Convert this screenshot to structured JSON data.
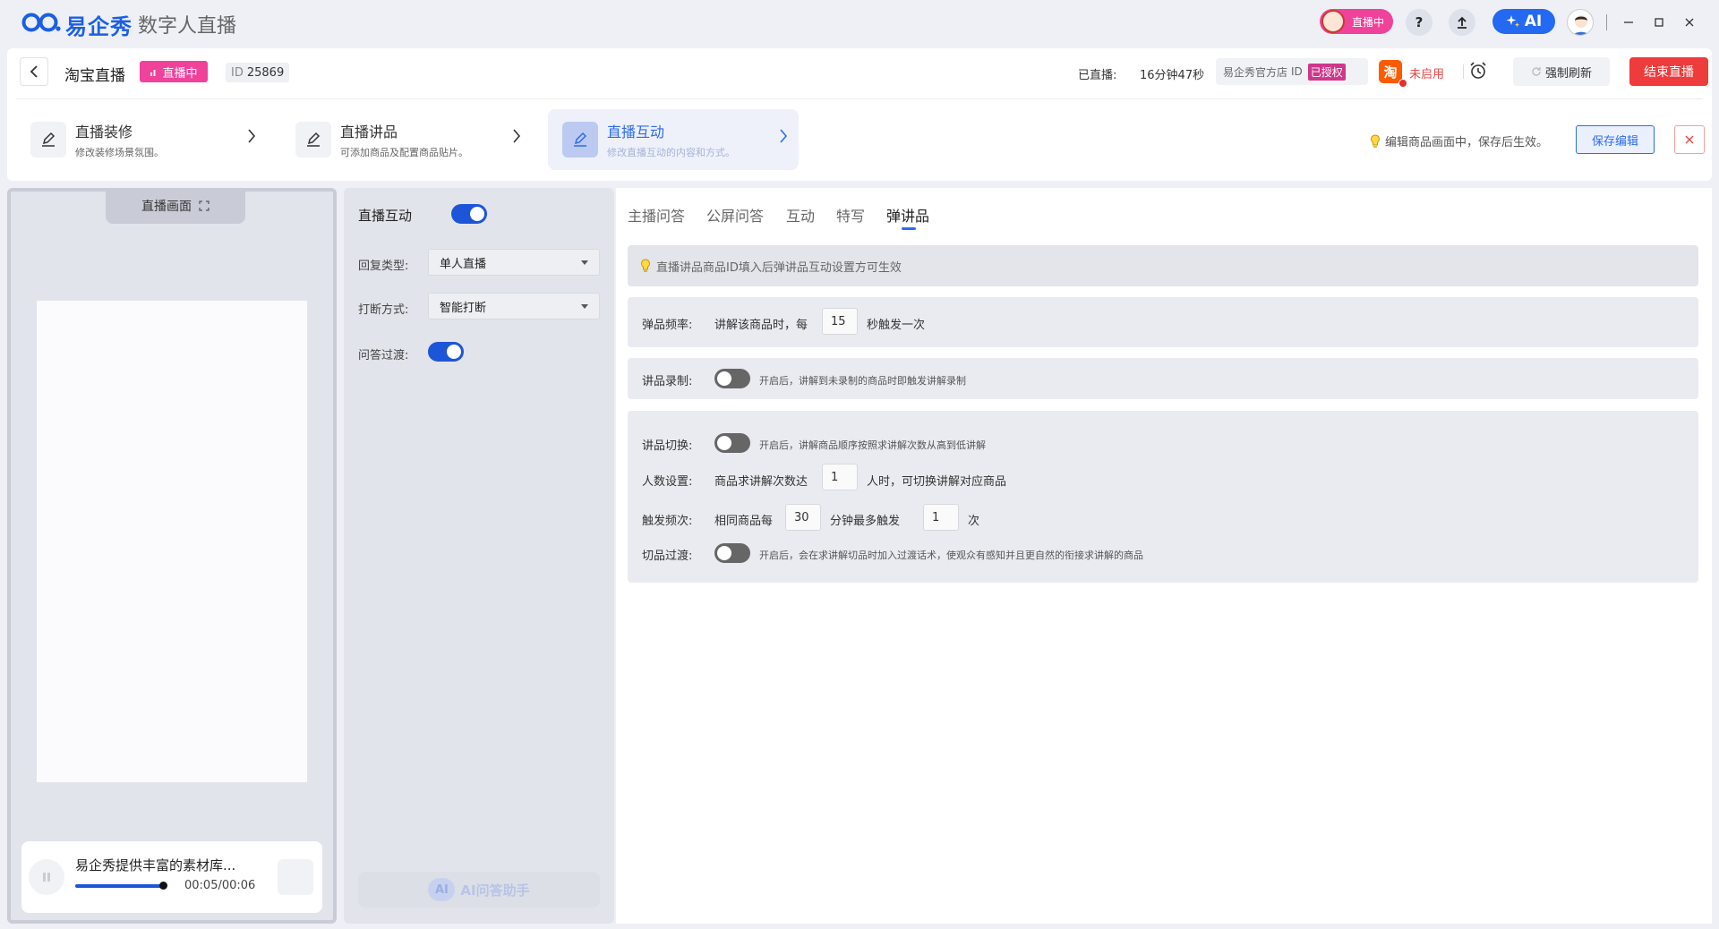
{
  "titlebar": {
    "logo_text": "易企秀",
    "app_name": "数字人直播",
    "live_pill": "直播中",
    "help_label": "?",
    "ai_label": "AI"
  },
  "header": {
    "page_title": "淘宝直播",
    "status_badge": "直播中",
    "id_label": "ID",
    "id_value": "25869",
    "duration_label": "已直播:",
    "duration_value": "16分钟47秒",
    "shop_name": "易企秀官方店",
    "shop_id_label": "ID",
    "auth_badge": "已授权",
    "taobao_logo": "淘",
    "not_enabled": "未启用",
    "refresh_button": "强制刷新",
    "end_button": "结束直播",
    "tip": "编辑商品画面中，保存后生效。",
    "save_button": "保存编辑",
    "steps": [
      {
        "title": "直播装修",
        "desc": "修改装修场景氛围。"
      },
      {
        "title": "直播讲品",
        "desc": "可添加商品及配置商品贴片。"
      },
      {
        "title": "直播互动",
        "desc": "修改直播互动的内容和方式。"
      }
    ]
  },
  "preview": {
    "tab_label": "直播画面",
    "player_title": "易企秀提供丰富的素材库...",
    "player_time": "00:05/00:06",
    "progress_fraction": 0.83
  },
  "settings": {
    "title": "直播互动",
    "title_toggle_on": true,
    "reply_type_label": "回复类型:",
    "reply_type_value": "单人直播",
    "interrupt_label": "打断方式:",
    "interrupt_value": "智能打断",
    "qa_transition_label": "问答过渡:",
    "qa_transition_on": true,
    "ai_helper_badge": "AI",
    "ai_helper_label": "AI问答助手"
  },
  "main": {
    "tabs": [
      "主播问答",
      "公屏问答",
      "互动",
      "特写",
      "弹讲品"
    ],
    "active_tab": "弹讲品",
    "banner_text": "直播讲品商品ID填入后弹讲品互动设置方可生效",
    "popup_freq": {
      "label": "弹品频率:",
      "prefix": "讲解该商品时，每",
      "value": "15",
      "suffix": "秒触发一次"
    },
    "recording": {
      "label": "讲品录制:",
      "toggle_on": false,
      "desc": "开启后，讲解到未录制的商品时即触发讲解录制"
    },
    "switch": {
      "label": "讲品切换:",
      "toggle_on": false,
      "desc": "开启后，讲解商品顺序按照求讲解次数从高到低讲解"
    },
    "people": {
      "label": "人数设置:",
      "prefix": "商品求讲解次数达",
      "value": "1",
      "suffix": "人时，可切换讲解对应商品"
    },
    "trigger": {
      "label": "触发频次:",
      "prefix": "相同商品每",
      "value1": "30",
      "middle": "分钟最多触发",
      "value2": "1",
      "suffix": "次"
    },
    "transition": {
      "label": "切品过渡:",
      "toggle_on": false,
      "desc": "开启后，会在求讲解切品时加入过渡话术，使观众有感知并且更自然的衔接求讲解的商品"
    }
  },
  "colors": {
    "accent": "#2d6bf0",
    "brand": "#1c5fe4",
    "live_pink": "#f0429b",
    "danger": "#ee3b3b"
  }
}
